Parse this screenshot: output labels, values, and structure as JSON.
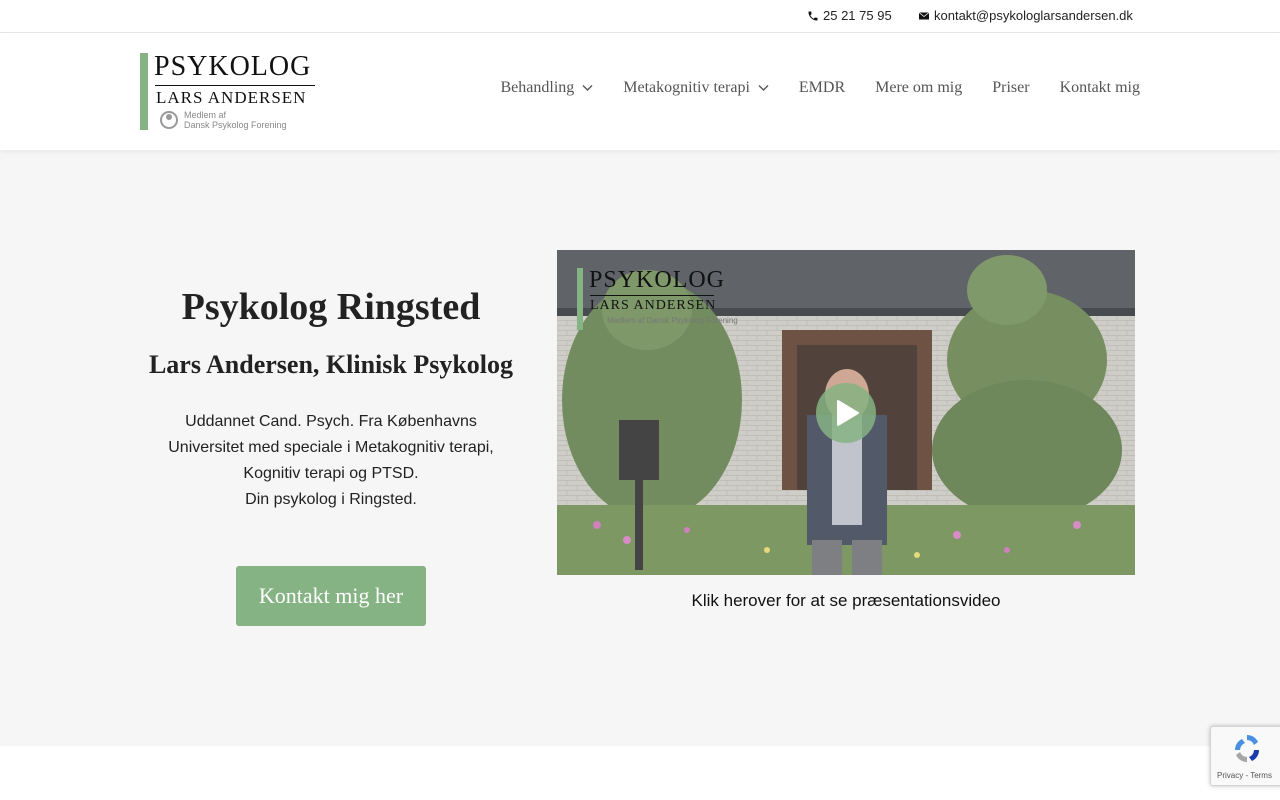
{
  "topbar": {
    "phone": "25 21 75 95",
    "email": "kontakt@psykologlarsandersen.dk",
    "phone_icon": "phone-icon",
    "email_icon": "envelope-icon"
  },
  "logo": {
    "line1": "PSYKOLOG",
    "line2": "LARS ANDERSEN",
    "line3a": "Medlem af",
    "line3b": "Dansk Psykolog Forening"
  },
  "nav": {
    "items": [
      {
        "label": "Behandling",
        "has_dropdown": true
      },
      {
        "label": "Metakognitiv terapi",
        "has_dropdown": true
      },
      {
        "label": "EMDR",
        "has_dropdown": false
      },
      {
        "label": "Mere om mig",
        "has_dropdown": false
      },
      {
        "label": "Priser",
        "has_dropdown": false
      },
      {
        "label": "Kontakt mig",
        "has_dropdown": false
      }
    ]
  },
  "hero": {
    "title": "Psykolog Ringsted",
    "subtitle": "Lars Andersen, Klinisk Psykolog",
    "desc_lines": [
      "Uddannet Cand. Psych. Fra Københavns",
      "Universitet med speciale i Metakognitiv terapi,",
      "Kognitiv terapi og PTSD.",
      "Din psykolog i Ringsted."
    ],
    "cta_label": "Kontakt mig her"
  },
  "video": {
    "logo_line1": "PSYKOLOG",
    "logo_line2": "LARS ANDERSEN",
    "logo_line3": "Medlem af Dansk Psykolog Forening",
    "caption": "Klik herover for at se præsentationsvideo",
    "play_icon": "play-icon"
  },
  "recaptcha": {
    "links": "Privacy - Terms"
  },
  "colors": {
    "accent": "#86b383",
    "hero_bg": "#f6f6f6",
    "nav_text": "#555555"
  }
}
